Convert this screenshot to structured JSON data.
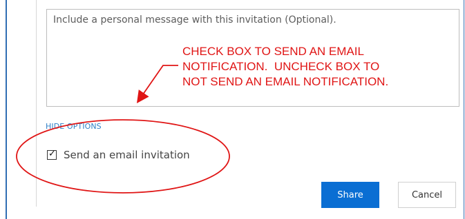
{
  "message": {
    "placeholder": "Include a personal message with this invitation (Optional)."
  },
  "annotation": {
    "text": "CHECK BOX TO SEND AN EMAIL\nNOTIFICATION.  UNCHECK BOX TO\nNOT SEND AN EMAIL NOTIFICATION."
  },
  "options": {
    "toggle_label": "HIDE OPTIONS",
    "email_checkbox_label": "Send an email invitation",
    "email_checkbox_checked": true
  },
  "buttons": {
    "share_label": "Share",
    "cancel_label": "Cancel",
    "share_color": "#0a6ed3"
  },
  "markup": {
    "color": "#e01515"
  }
}
